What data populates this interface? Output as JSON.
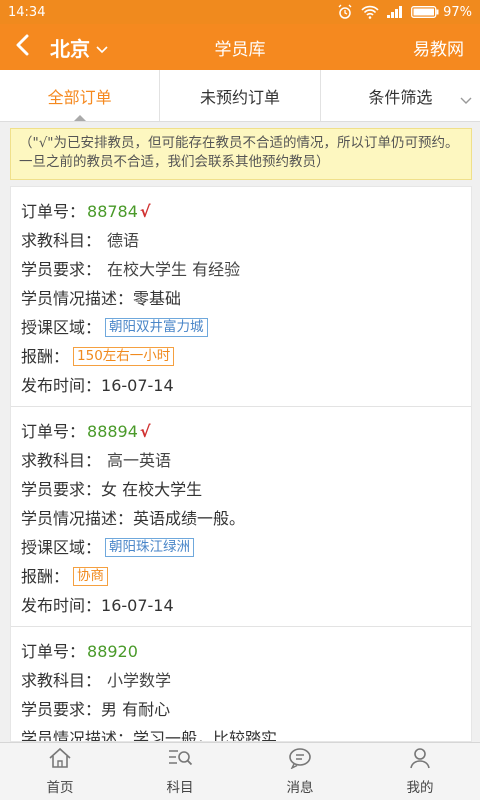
{
  "status": {
    "time": "14:34",
    "battery": "97%"
  },
  "header": {
    "city": "北京",
    "title": "学员库",
    "brand": "易教网"
  },
  "tabs": [
    {
      "label": "全部订单"
    },
    {
      "label": "未预约订单"
    },
    {
      "label": "条件筛选"
    }
  ],
  "notice": "（\"√\"为已安排教员，但可能存在教员不合适的情况，所以订单仍可预约。一旦之前的教员不合适，我们会联系其他预约教员）",
  "labels": {
    "order_no": "订单号：",
    "subject": "求教科目：",
    "requirement": "学员要求：",
    "description": "学员情况描述：",
    "area": "授课区域：",
    "pay": "报酬：",
    "published": "发布时间："
  },
  "orders": [
    {
      "order_no": "88784",
      "check": "√",
      "subject": "德语",
      "requirement": "在校大学生 有经验",
      "description": "零基础",
      "area": "朝阳双井富力城",
      "pay": "150左右一小时",
      "published": "16-07-14"
    },
    {
      "order_no": "88894",
      "check": "√",
      "subject": "高一英语",
      "requirement": "女 在校大学生",
      "description": "英语成绩一般。",
      "area": "朝阳珠江绿洲",
      "pay": "协商",
      "published": "16-07-14"
    },
    {
      "order_no": "88920",
      "check": "",
      "subject": "小学数学",
      "requirement": "男 有耐心",
      "description": "学习一般，比较踏实"
    }
  ],
  "nav": [
    {
      "label": "首页",
      "icon": "home-icon"
    },
    {
      "label": "科目",
      "icon": "subject-search-icon"
    },
    {
      "label": "消息",
      "icon": "message-icon"
    },
    {
      "label": "我的",
      "icon": "user-icon"
    }
  ],
  "colors": {
    "accent": "#f5891f",
    "order_no": "#4a9a2a",
    "check": "#d03030",
    "area_tag": "#4a86c8",
    "pay_tag": "#f08a1e",
    "notice_bg": "#fdf7c0"
  }
}
